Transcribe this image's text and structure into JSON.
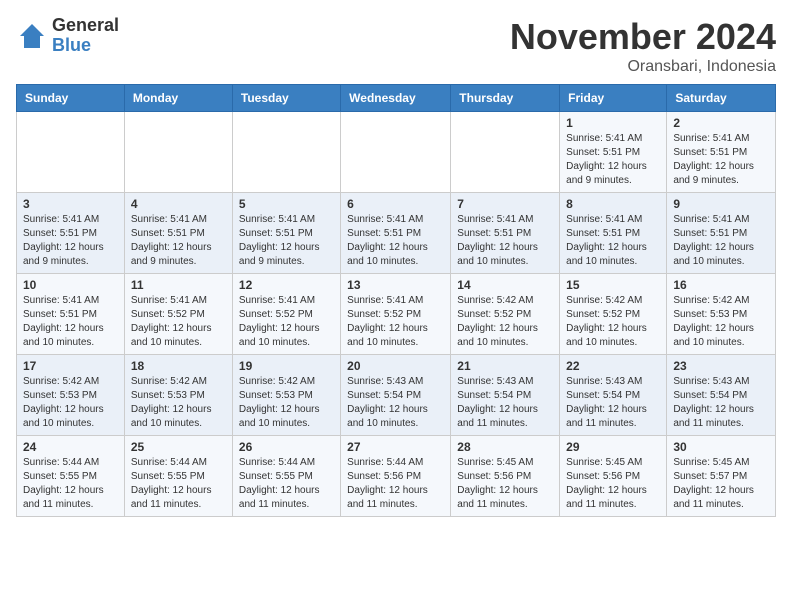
{
  "logo": {
    "general": "General",
    "blue": "Blue"
  },
  "header": {
    "month": "November 2024",
    "location": "Oransbari, Indonesia"
  },
  "weekdays": [
    "Sunday",
    "Monday",
    "Tuesday",
    "Wednesday",
    "Thursday",
    "Friday",
    "Saturday"
  ],
  "weeks": [
    [
      {
        "day": "",
        "info": ""
      },
      {
        "day": "",
        "info": ""
      },
      {
        "day": "",
        "info": ""
      },
      {
        "day": "",
        "info": ""
      },
      {
        "day": "",
        "info": ""
      },
      {
        "day": "1",
        "info": "Sunrise: 5:41 AM\nSunset: 5:51 PM\nDaylight: 12 hours and 9 minutes."
      },
      {
        "day": "2",
        "info": "Sunrise: 5:41 AM\nSunset: 5:51 PM\nDaylight: 12 hours and 9 minutes."
      }
    ],
    [
      {
        "day": "3",
        "info": "Sunrise: 5:41 AM\nSunset: 5:51 PM\nDaylight: 12 hours and 9 minutes."
      },
      {
        "day": "4",
        "info": "Sunrise: 5:41 AM\nSunset: 5:51 PM\nDaylight: 12 hours and 9 minutes."
      },
      {
        "day": "5",
        "info": "Sunrise: 5:41 AM\nSunset: 5:51 PM\nDaylight: 12 hours and 9 minutes."
      },
      {
        "day": "6",
        "info": "Sunrise: 5:41 AM\nSunset: 5:51 PM\nDaylight: 12 hours and 10 minutes."
      },
      {
        "day": "7",
        "info": "Sunrise: 5:41 AM\nSunset: 5:51 PM\nDaylight: 12 hours and 10 minutes."
      },
      {
        "day": "8",
        "info": "Sunrise: 5:41 AM\nSunset: 5:51 PM\nDaylight: 12 hours and 10 minutes."
      },
      {
        "day": "9",
        "info": "Sunrise: 5:41 AM\nSunset: 5:51 PM\nDaylight: 12 hours and 10 minutes."
      }
    ],
    [
      {
        "day": "10",
        "info": "Sunrise: 5:41 AM\nSunset: 5:51 PM\nDaylight: 12 hours and 10 minutes."
      },
      {
        "day": "11",
        "info": "Sunrise: 5:41 AM\nSunset: 5:52 PM\nDaylight: 12 hours and 10 minutes."
      },
      {
        "day": "12",
        "info": "Sunrise: 5:41 AM\nSunset: 5:52 PM\nDaylight: 12 hours and 10 minutes."
      },
      {
        "day": "13",
        "info": "Sunrise: 5:41 AM\nSunset: 5:52 PM\nDaylight: 12 hours and 10 minutes."
      },
      {
        "day": "14",
        "info": "Sunrise: 5:42 AM\nSunset: 5:52 PM\nDaylight: 12 hours and 10 minutes."
      },
      {
        "day": "15",
        "info": "Sunrise: 5:42 AM\nSunset: 5:52 PM\nDaylight: 12 hours and 10 minutes."
      },
      {
        "day": "16",
        "info": "Sunrise: 5:42 AM\nSunset: 5:53 PM\nDaylight: 12 hours and 10 minutes."
      }
    ],
    [
      {
        "day": "17",
        "info": "Sunrise: 5:42 AM\nSunset: 5:53 PM\nDaylight: 12 hours and 10 minutes."
      },
      {
        "day": "18",
        "info": "Sunrise: 5:42 AM\nSunset: 5:53 PM\nDaylight: 12 hours and 10 minutes."
      },
      {
        "day": "19",
        "info": "Sunrise: 5:42 AM\nSunset: 5:53 PM\nDaylight: 12 hours and 10 minutes."
      },
      {
        "day": "20",
        "info": "Sunrise: 5:43 AM\nSunset: 5:54 PM\nDaylight: 12 hours and 10 minutes."
      },
      {
        "day": "21",
        "info": "Sunrise: 5:43 AM\nSunset: 5:54 PM\nDaylight: 12 hours and 11 minutes."
      },
      {
        "day": "22",
        "info": "Sunrise: 5:43 AM\nSunset: 5:54 PM\nDaylight: 12 hours and 11 minutes."
      },
      {
        "day": "23",
        "info": "Sunrise: 5:43 AM\nSunset: 5:54 PM\nDaylight: 12 hours and 11 minutes."
      }
    ],
    [
      {
        "day": "24",
        "info": "Sunrise: 5:44 AM\nSunset: 5:55 PM\nDaylight: 12 hours and 11 minutes."
      },
      {
        "day": "25",
        "info": "Sunrise: 5:44 AM\nSunset: 5:55 PM\nDaylight: 12 hours and 11 minutes."
      },
      {
        "day": "26",
        "info": "Sunrise: 5:44 AM\nSunset: 5:55 PM\nDaylight: 12 hours and 11 minutes."
      },
      {
        "day": "27",
        "info": "Sunrise: 5:44 AM\nSunset: 5:56 PM\nDaylight: 12 hours and 11 minutes."
      },
      {
        "day": "28",
        "info": "Sunrise: 5:45 AM\nSunset: 5:56 PM\nDaylight: 12 hours and 11 minutes."
      },
      {
        "day": "29",
        "info": "Sunrise: 5:45 AM\nSunset: 5:56 PM\nDaylight: 12 hours and 11 minutes."
      },
      {
        "day": "30",
        "info": "Sunrise: 5:45 AM\nSunset: 5:57 PM\nDaylight: 12 hours and 11 minutes."
      }
    ]
  ]
}
